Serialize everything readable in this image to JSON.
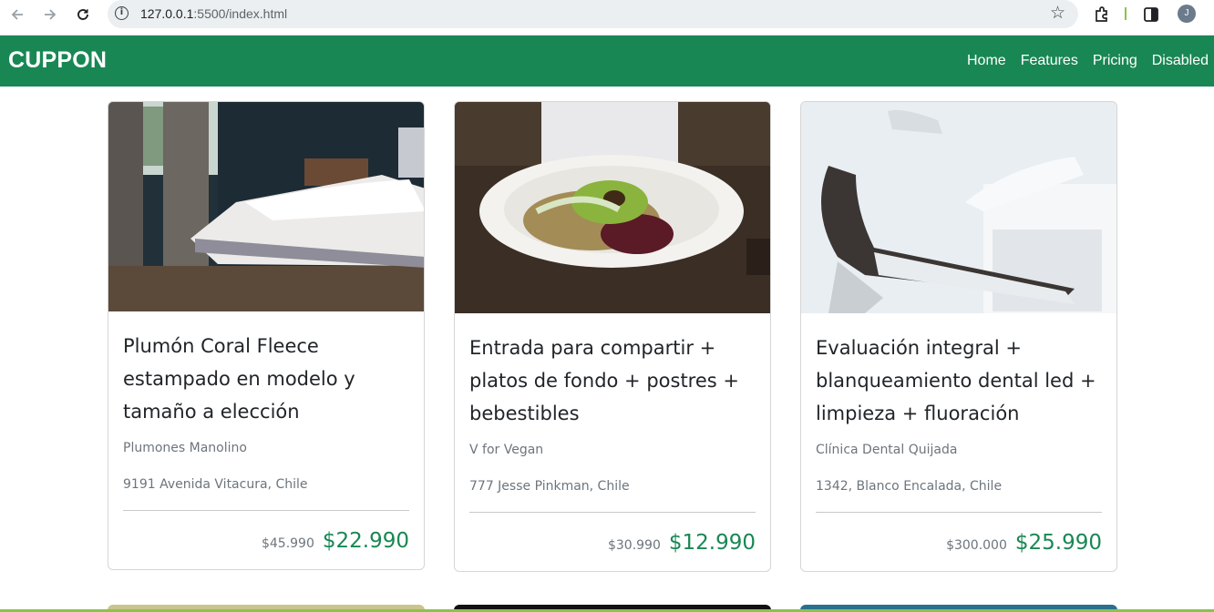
{
  "browser": {
    "url_host": "127.0.0.1",
    "url_path": ":5500/index.html",
    "avatar_initial": "J"
  },
  "navbar": {
    "brand": "CUPPON",
    "links": [
      "Home",
      "Features",
      "Pricing",
      "Disabled"
    ],
    "color": "#198754"
  },
  "cards": [
    {
      "title": "Plumón Coral Fleece estampado en modelo y tamaño a elección",
      "vendor": "Plumones Manolino",
      "address": "9191 Avenida Vitacura, Chile",
      "old_price": "$45.990",
      "new_price": "$22.990",
      "image": "bedroom-photo"
    },
    {
      "title": "Entrada para compartir + platos de fondo + postres + bebestibles",
      "vendor": "V for Vegan",
      "address": "777 Jesse Pinkman, Chile",
      "old_price": "$30.990",
      "new_price": "$12.990",
      "image": "vegan-plate-photo"
    },
    {
      "title": "Evaluación integral + blanqueamiento dental led + limpieza + fluoración",
      "vendor": "Clínica Dental Quijada",
      "address": "1342, Blanco Encalada, Chile",
      "old_price": "$300.000",
      "new_price": "$25.990",
      "image": "dental-chair-photo"
    }
  ]
}
